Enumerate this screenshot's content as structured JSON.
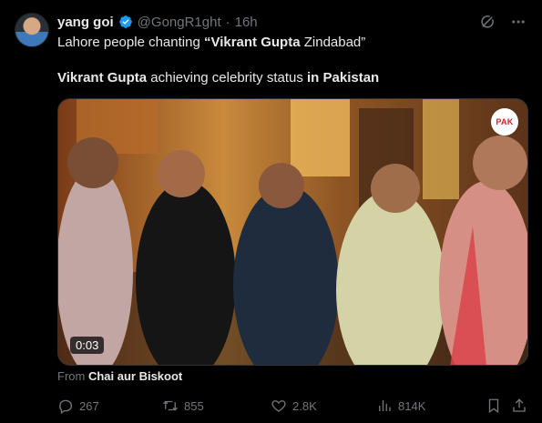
{
  "author": {
    "name": "yang goi",
    "handle": "@GongR1ght",
    "separator": "·",
    "time": "16h"
  },
  "text": {
    "line1_prefix": "Lahore people chanting ",
    "line1_bold": "“Vikrant Gupta",
    "line1_suffix": " Zindabad”",
    "line2_bold_a": "Vikrant Gupta",
    "line2_mid": " achieving celebrity status ",
    "line2_bold_b": "in Pakistan"
  },
  "media": {
    "duration": "0:03",
    "badge": "PAK"
  },
  "source": {
    "prefix": "From ",
    "name": "Chai aur Biskoot"
  },
  "actions": {
    "replies": "267",
    "reposts": "855",
    "likes": "2.8K",
    "views": "814K"
  },
  "icons": [
    "grok-icon",
    "more-icon",
    "verified-icon",
    "reply-icon",
    "repost-icon",
    "like-icon",
    "views-icon",
    "bookmark-icon",
    "share-icon"
  ],
  "colors": {
    "background": "#000000",
    "text": "#e7e9ea",
    "muted": "#71767b",
    "verified": "#1d9bf0"
  }
}
